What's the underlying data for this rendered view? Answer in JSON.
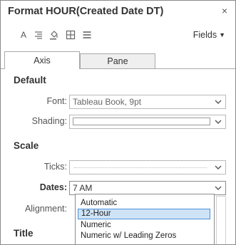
{
  "window": {
    "title": "Format HOUR(Created Date DT)",
    "close_glyph": "×"
  },
  "toolbar": {
    "icons": [
      "font-icon",
      "alignment-icon",
      "shading-icon",
      "borders-icon",
      "lines-icon"
    ],
    "font_icon_glyph": "A",
    "fields_label": "Fields",
    "fields_caret": "▼"
  },
  "tabs": [
    {
      "label": "Axis",
      "active": true
    },
    {
      "label": "Pane",
      "active": false
    }
  ],
  "default_section": {
    "heading": "Default",
    "font_label": "Font:",
    "font_value": "Tableau Book, 9pt",
    "shading_label": "Shading:"
  },
  "scale_section": {
    "heading": "Scale",
    "ticks_label": "Ticks:",
    "dates_label": "Dates:",
    "dates_value": "7 AM",
    "alignment_label": "Alignment:"
  },
  "title_section": {
    "heading": "Title"
  },
  "dates_menu": {
    "options": [
      "Automatic",
      "12-Hour",
      "Numeric",
      "Numeric w/ Leading Zeros"
    ],
    "selected": "12-Hour"
  },
  "colors": {
    "selection_fill": "#cfe3f7",
    "selection_border": "#4a90d9"
  }
}
